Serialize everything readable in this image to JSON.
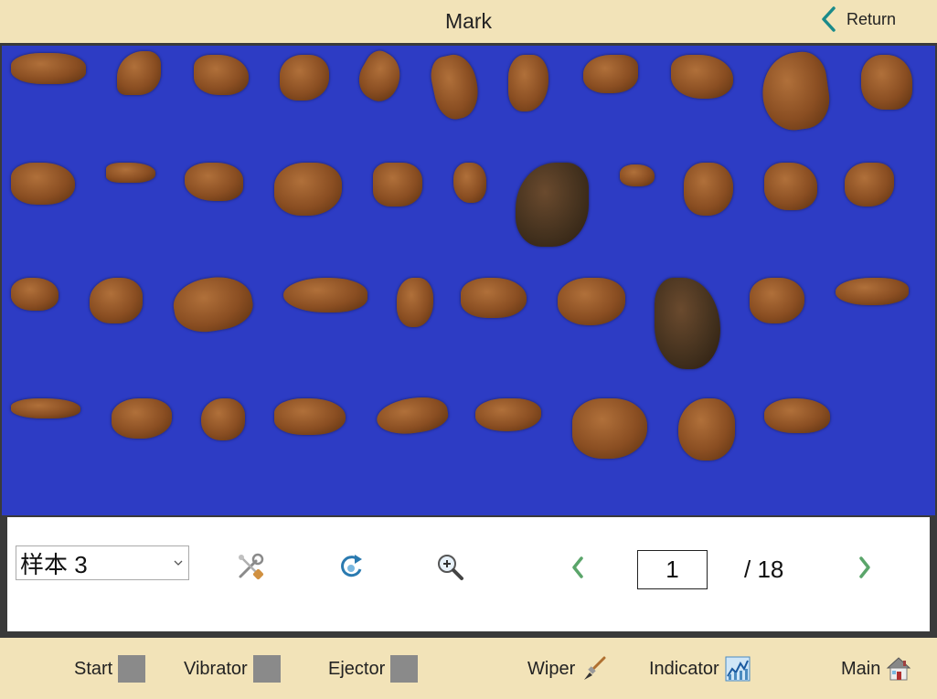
{
  "header": {
    "title": "Mark",
    "return_label": "Return"
  },
  "controls": {
    "sample_value": "样本 3",
    "page_current": "1",
    "page_total": "/ 18"
  },
  "colors": {
    "background": "#f2e3b8",
    "viewer_bg": "#2d3cc4",
    "nav_arrow": "#5aa56a",
    "return_arrow": "#1a8a8a",
    "indicator_gray": "#8a8a8a"
  },
  "footer": {
    "start_label": "Start",
    "vibrator_label": "Vibrator",
    "ejector_label": "Ejector",
    "wiper_label": "Wiper",
    "indicator_label": "Indicator",
    "main_label": "Main"
  },
  "icons": {
    "return": "chevron-left-icon",
    "tools": "tools-icon",
    "rotate": "rotate-icon",
    "zoom": "zoom-in-icon",
    "prev": "chevron-left-icon",
    "next": "chevron-right-icon",
    "wiper": "brush-icon",
    "indicator": "chart-icon",
    "main": "house-icon"
  }
}
